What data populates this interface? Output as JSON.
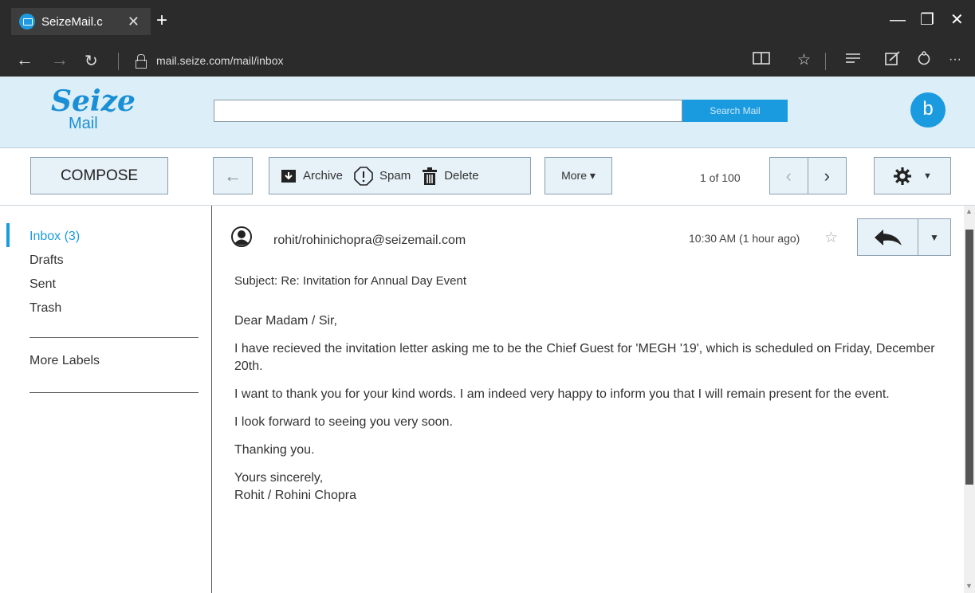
{
  "browser": {
    "tab_title": "SeizeMail.c",
    "tab_close": "✕",
    "new_tab": "+",
    "url": "mail.seize.com/mail/inbox"
  },
  "header": {
    "logo_top": "Seize",
    "logo_bottom": "Mail",
    "search_placeholder": "",
    "search_button": "Search Mail",
    "avatar_letter": "b"
  },
  "toolbar": {
    "compose": "COMPOSE",
    "archive": "Archive",
    "spam": "Spam",
    "delete": "Delete",
    "more": "More ▾",
    "page_count": "1 of 100"
  },
  "sidebar": {
    "items": [
      {
        "label": "Inbox (3)",
        "active": true
      },
      {
        "label": "Drafts",
        "active": false
      },
      {
        "label": "Sent",
        "active": false
      },
      {
        "label": "Trash",
        "active": false
      }
    ],
    "more_labels": "More Labels"
  },
  "email": {
    "sender": "rohit/rohinichopra@seizemail.com",
    "timestamp": "10:30 AM (1 hour ago)",
    "subject": "Subject:  Re:  Invitation for Annual Day Event",
    "body": [
      "Dear Madam / Sir,",
      "I have recieved the invitation letter asking me to be the Chief Guest for 'MEGH '19', which is scheduled on Friday, December 20th.",
      "I want to thank you for your kind words. I am indeed very happy to inform you that I will remain present for the event.",
      "I look forward to seeing you very soon.",
      "Thanking you.",
      "Yours sincerely,",
      "Rohit / Rohini Chopra"
    ]
  },
  "colors": {
    "accent": "#1a9be0",
    "header_bg": "#dceef8",
    "button_bg": "#e7f1f8",
    "chrome_bg": "#2b2b2b"
  }
}
